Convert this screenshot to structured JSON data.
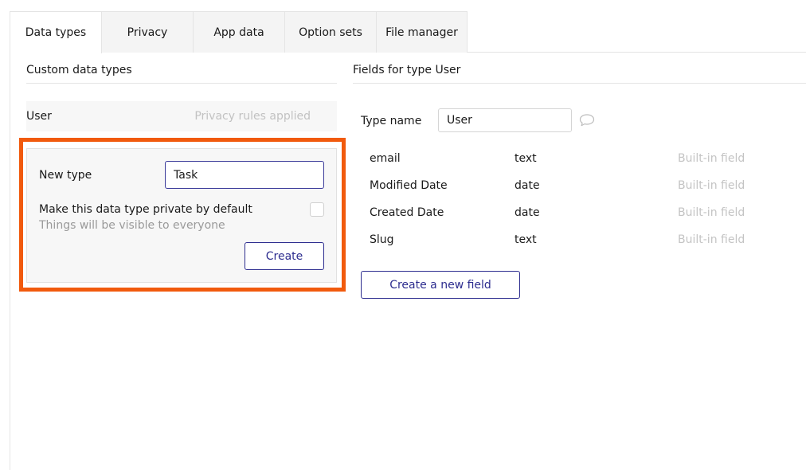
{
  "tabs": [
    {
      "label": "Data types",
      "active": true
    },
    {
      "label": "Privacy",
      "active": false
    },
    {
      "label": "App data",
      "active": false
    },
    {
      "label": "Option sets",
      "active": false
    },
    {
      "label": "File manager",
      "active": false
    }
  ],
  "left_panel": {
    "title": "Custom data types",
    "types": [
      {
        "name": "User",
        "meta": "Privacy rules applied"
      }
    ],
    "new_type": {
      "label": "New type",
      "value": "Task",
      "private_label": "Make this data type private by default",
      "private_hint": "Things will be visible to everyone",
      "private_checked": false,
      "create_label": "Create"
    }
  },
  "right_panel": {
    "title": "Fields for type User",
    "type_name_label": "Type name",
    "type_name_value": "User",
    "fields": [
      {
        "name": "email",
        "type": "text",
        "meta": "Built-in field"
      },
      {
        "name": "Modified Date",
        "type": "date",
        "meta": "Built-in field"
      },
      {
        "name": "Created Date",
        "type": "date",
        "meta": "Built-in field"
      },
      {
        "name": "Slug",
        "type": "text",
        "meta": "Built-in field"
      }
    ],
    "new_field_label": "Create a new field"
  },
  "colors": {
    "highlight": "#f15a0d",
    "primary": "#2d2d8f",
    "muted": "#c4c4c4"
  },
  "icons": {
    "comment": "comment-bubble-icon"
  }
}
